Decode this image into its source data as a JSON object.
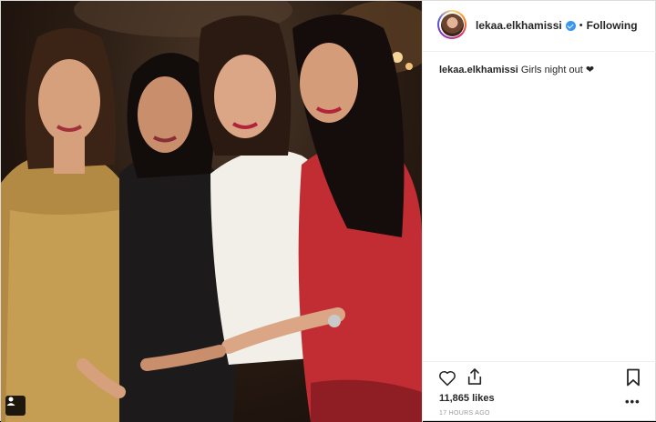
{
  "header": {
    "username": "lekaa.elkhamissi",
    "separator": "•",
    "follow_status": "Following"
  },
  "caption": {
    "username": "lekaa.elkhamissi",
    "text": "Girls night out ❤"
  },
  "stats": {
    "likes": "11,865 likes",
    "timestamp": "17 HOURS AGO"
  },
  "actions": {
    "like_icon": "heart-icon",
    "share_icon": "share-icon",
    "save_icon": "bookmark-icon",
    "more_label": "•••"
  },
  "colors": {
    "verified": "#3897f0",
    "text": "#262626",
    "muted": "#999999",
    "border": "#efefef"
  }
}
